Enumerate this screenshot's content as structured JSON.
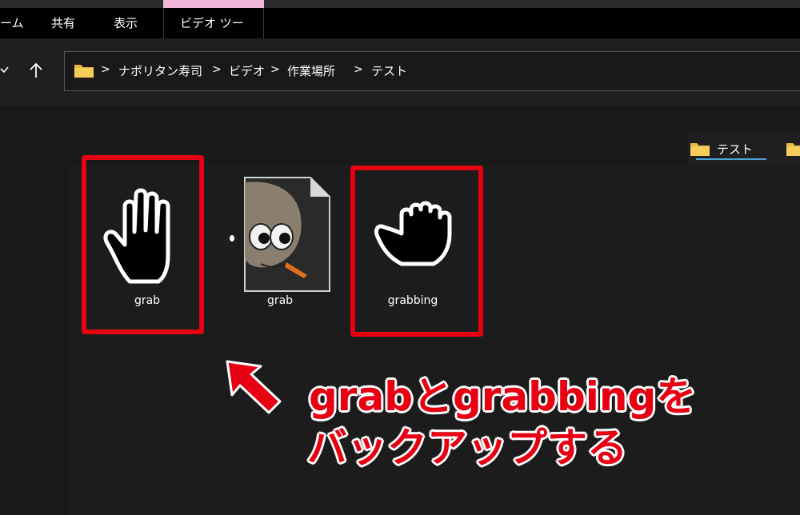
{
  "ribbon": {
    "tabs": [
      "ーム",
      "共有",
      "表示",
      "ビデオ ツール"
    ]
  },
  "address_bar": {
    "path": [
      "ナポリタン寿司",
      "ビデオ",
      "作業場所",
      "テスト"
    ],
    "separator": ">"
  },
  "quick_access": {
    "items": [
      "テスト"
    ]
  },
  "files": [
    {
      "name": "grab",
      "icon": "hand-open-cursor-icon",
      "highlighted": true
    },
    {
      "name": "grab",
      "icon": "gimp-file-icon",
      "highlighted": false
    },
    {
      "name": "grabbing",
      "icon": "hand-closed-cursor-icon",
      "highlighted": true
    }
  ],
  "annotation": {
    "line1": "grabとgrabbingを",
    "line2": "バックアップする",
    "color": "#e60012"
  }
}
